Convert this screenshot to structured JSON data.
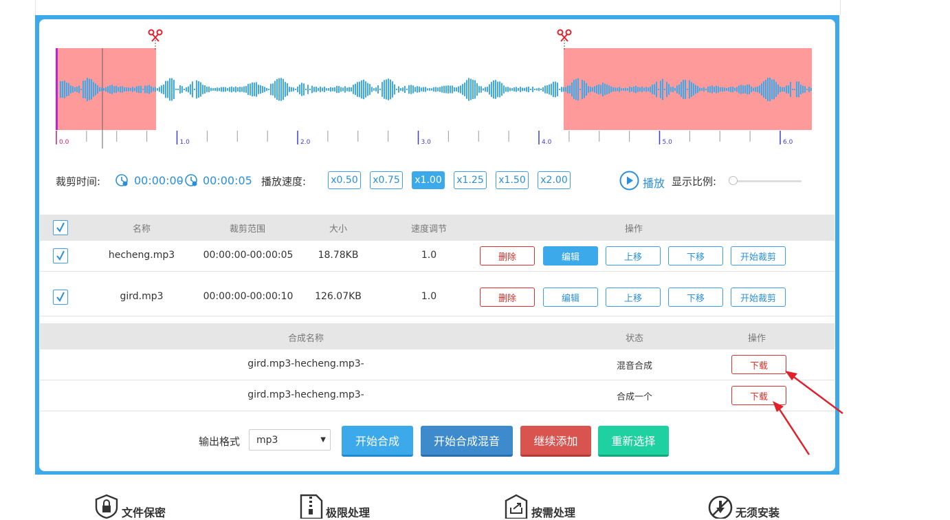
{
  "waveform": {
    "ticks": [
      "0.0",
      "1.0",
      "2.0",
      "3.0",
      "4.0",
      "5.0",
      "6.0"
    ],
    "colors": {
      "wave": "#3ba9ea",
      "selection": "#ff9a9a",
      "playhead": "#c020e0",
      "tick_major": "#3d3dcf"
    },
    "icons": [
      "scissors-icon",
      "scissors-icon"
    ]
  },
  "controls": {
    "cut_time_label": "裁剪时间:",
    "start_time": "00:00:00",
    "dash": "-",
    "end_time": "00:00:05",
    "speed_label": "播放速度:",
    "speeds": [
      "x0.50",
      "x0.75",
      "x1.00",
      "x1.25",
      "x1.50",
      "x2.00"
    ],
    "active_speed": "x1.00",
    "play_label": "播放",
    "zoom_label": "显示比例:"
  },
  "files_table": {
    "headers": [
      "名称",
      "裁剪范围",
      "大小",
      "速度调节",
      "操作"
    ],
    "rows": [
      {
        "name": "hecheng.mp3",
        "range": "00:00:00-00:00:05",
        "size": "18.78KB",
        "speed": "1.0",
        "actions": [
          "删除",
          "编辑",
          "上移",
          "下移",
          "开始裁剪"
        ]
      },
      {
        "name": "gird.mp3",
        "range": "00:00:00-00:00:10",
        "size": "126.07KB",
        "speed": "1.0",
        "actions": [
          "删除",
          "编辑",
          "上移",
          "下移",
          "开始裁剪"
        ]
      }
    ]
  },
  "merge_table": {
    "headers": [
      "合成名称",
      "状态",
      "操作"
    ],
    "rows": [
      {
        "name": "gird.mp3-hecheng.mp3-",
        "status": "混音合成",
        "action": "下载"
      },
      {
        "name": "gird.mp3-hecheng.mp3-",
        "status": "合成一个",
        "action": "下载"
      }
    ]
  },
  "footer_controls": {
    "format_label": "输出格式",
    "format_value": "mp3",
    "buttons": [
      "开始合成",
      "开始合成混音",
      "继续添加",
      "重新选择"
    ],
    "button_colors": [
      "#3ba9ea",
      "#3d8bcd",
      "#d9534f",
      "#1fd1a0"
    ]
  },
  "features": [
    {
      "icon": "lock-shield-icon",
      "label": "文件保密"
    },
    {
      "icon": "zip-file-icon",
      "label": "极限处理"
    },
    {
      "icon": "export-icon",
      "label": "按需处理"
    },
    {
      "icon": "no-install-icon",
      "label": "无须安装"
    }
  ]
}
